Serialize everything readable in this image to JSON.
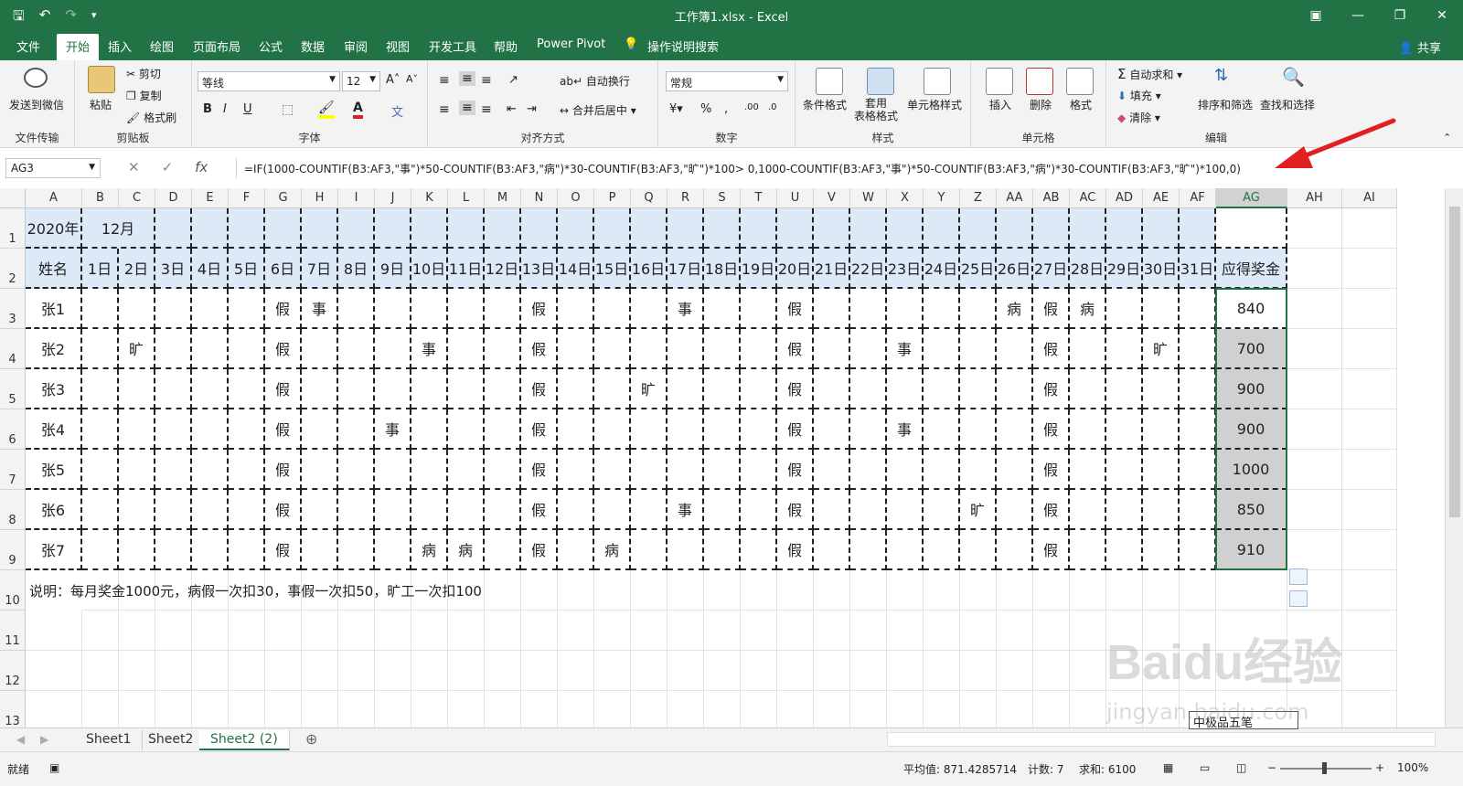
{
  "window": {
    "title": "工作簿1.xlsx  -  Excel",
    "share": "共享"
  },
  "menu": {
    "tabs": [
      "文件",
      "开始",
      "插入",
      "绘图",
      "页面布局",
      "公式",
      "数据",
      "审阅",
      "视图",
      "开发工具",
      "帮助",
      "Power Pivot",
      "操作说明搜索"
    ],
    "active": "开始"
  },
  "ribbon": {
    "file_transfer": {
      "button": "发送到微信",
      "label": "文件传输"
    },
    "clipboard": {
      "paste": "粘贴",
      "cut": "剪切",
      "copy": "复制",
      "format_painter": "格式刷",
      "label": "剪贴板"
    },
    "font": {
      "name": "等线",
      "size": "12",
      "label": "字体"
    },
    "alignment": {
      "wrap": "自动换行",
      "merge": "合并后居中",
      "label": "对齐方式"
    },
    "number": {
      "format": "常规",
      "label": "数字"
    },
    "styles": {
      "conditional": "条件格式",
      "table": "套用\n表格格式",
      "cell": "单元格样式",
      "label": "样式"
    },
    "cells": {
      "insert": "插入",
      "delete": "删除",
      "format": "格式",
      "label": "单元格"
    },
    "editing": {
      "autosum": "自动求和",
      "fill": "填充",
      "clear": "清除",
      "sort": "排序和筛选",
      "find": "查找和选择",
      "label": "编辑"
    }
  },
  "formula_bar": {
    "name_box": "AG3",
    "formula": "=IF(1000-COUNTIF(B3:AF3,\"事\")*50-COUNTIF(B3:AF3,\"病\")*30-COUNTIF(B3:AF3,\"旷\")*100> 0,1000-COUNTIF(B3:AF3,\"事\")*50-COUNTIF(B3:AF3,\"病\")*30-COUNTIF(B3:AF3,\"旷\")*100,0)"
  },
  "columns": [
    "A",
    "B",
    "C",
    "D",
    "E",
    "F",
    "G",
    "H",
    "I",
    "J",
    "K",
    "L",
    "M",
    "N",
    "O",
    "P",
    "Q",
    "R",
    "S",
    "T",
    "U",
    "V",
    "W",
    "X",
    "Y",
    "Z",
    "AA",
    "AB",
    "AC",
    "AD",
    "AE",
    "AF",
    "AG",
    "AH",
    "AI"
  ],
  "rows": [
    "1",
    "2",
    "3",
    "4",
    "5",
    "6",
    "7",
    "8",
    "9",
    "10",
    "11",
    "12",
    "13"
  ],
  "sheet": {
    "year": "2020年",
    "month": "12月",
    "name_header": "姓名",
    "day_headers": [
      "1日",
      "2日",
      "3日",
      "4日",
      "5日",
      "6日",
      "7日",
      "8日",
      "9日",
      "10日",
      "11日",
      "12日",
      "13日",
      "14日",
      "15日",
      "16日",
      "17日",
      "18日",
      "19日",
      "20日",
      "21日",
      "22日",
      "23日",
      "24日",
      "25日",
      "26日",
      "27日",
      "28日",
      "29日",
      "30日",
      "31日"
    ],
    "bonus_header": "应得奖金",
    "employees": [
      {
        "name": "张1",
        "marks": {
          "6": "假",
          "7": "事",
          "13": "假",
          "17": "事",
          "20": "假",
          "26": "病",
          "27": "假",
          "28": "病"
        },
        "bonus": "840"
      },
      {
        "name": "张2",
        "marks": {
          "2": "旷",
          "6": "假",
          "10": "事",
          "13": "假",
          "20": "假",
          "23": "事",
          "27": "假",
          "30": "旷"
        },
        "bonus": "700"
      },
      {
        "name": "张3",
        "marks": {
          "6": "假",
          "13": "假",
          "16": "旷",
          "20": "假",
          "27": "假"
        },
        "bonus": "900"
      },
      {
        "name": "张4",
        "marks": {
          "6": "假",
          "9": "事",
          "13": "假",
          "20": "假",
          "23": "事",
          "27": "假"
        },
        "bonus": "900"
      },
      {
        "name": "张5",
        "marks": {
          "6": "假",
          "13": "假",
          "20": "假",
          "27": "假"
        },
        "bonus": "1000"
      },
      {
        "name": "张6",
        "marks": {
          "6": "假",
          "13": "假",
          "17": "事",
          "20": "假",
          "25": "旷",
          "27": "假"
        },
        "bonus": "850"
      },
      {
        "name": "张7",
        "marks": {
          "6": "假",
          "10": "病",
          "11": "病",
          "13": "假",
          "15": "病",
          "20": "假",
          "27": "假"
        },
        "bonus": "910"
      }
    ],
    "note": "说明：每月奖金1000元，病假一次扣30，事假一次扣50，旷工一次扣100"
  },
  "sheet_tabs": [
    "Sheet1",
    "Sheet2",
    "Sheet2 (2)"
  ],
  "active_sheet": "Sheet2 (2)",
  "status": {
    "ready": "就绪",
    "average": "平均值: 871.4285714",
    "count": "计数: 7",
    "sum": "求和: 6100",
    "zoom": "100%"
  },
  "ime": "中极品五笔",
  "watermark": {
    "brand": "Baidu经验",
    "url": "jingyan.baidu.com"
  },
  "colors": {
    "excel_green": "#217346",
    "header_fill": "#dce9f6",
    "selected_fill": "#d0d0d0",
    "arrow": "#e02020"
  }
}
